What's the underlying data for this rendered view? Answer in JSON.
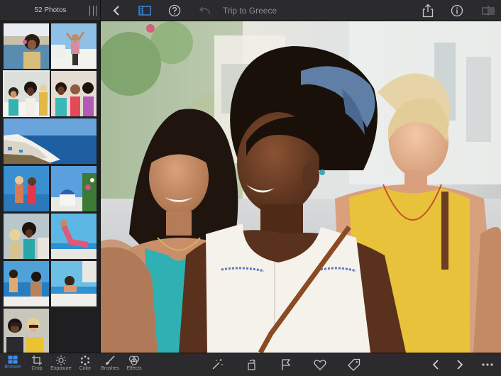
{
  "sidebar": {
    "photo_count": "52 Photos"
  },
  "header": {
    "title": "Trip to Greece"
  },
  "tools": [
    {
      "label": "Browse",
      "active": true
    },
    {
      "label": "Crop"
    },
    {
      "label": "Exposure"
    },
    {
      "label": "Color"
    },
    {
      "label": "Brushes"
    },
    {
      "label": "Effects"
    }
  ],
  "colors": {
    "accent": "#3a8ee6",
    "bar_bg": "#2b2b2d",
    "sidebar_bg": "#1f1f21"
  }
}
